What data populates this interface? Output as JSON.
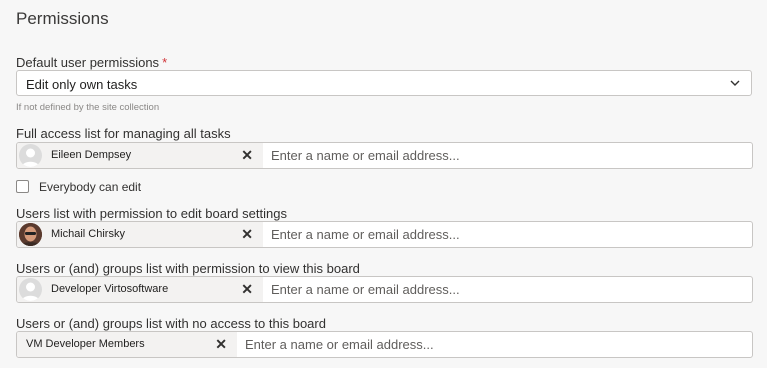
{
  "title": "Permissions",
  "default_perms": {
    "label": "Default user permissions",
    "required_mark": "*",
    "value": "Edit only own tasks",
    "hint": "If not defined by the site collection"
  },
  "full_access": {
    "label": "Full access list for managing all tasks",
    "chip_name": "Eileen Dempsey",
    "placeholder": "Enter a name or email address..."
  },
  "everybody_edit": {
    "label": "Everybody can edit",
    "checked": false
  },
  "edit_settings": {
    "label": "Users list with permission to edit board settings",
    "chip_name": "Michail Chirsky",
    "placeholder": "Enter a name or email address..."
  },
  "view_board": {
    "label": "Users or (and) groups list with permission to view this board",
    "chip_name": "Developer Virtosoftware",
    "placeholder": "Enter a name or email address..."
  },
  "no_access": {
    "label": "Users or (and) groups list with no access to this board",
    "chip_name": "VM Developer Members",
    "placeholder": "Enter a name or email address..."
  },
  "remove_glyph": "✕",
  "colors": {
    "required": "#d13438",
    "chip_bg": "#f3f2f1",
    "border": "#c8c6c4"
  }
}
